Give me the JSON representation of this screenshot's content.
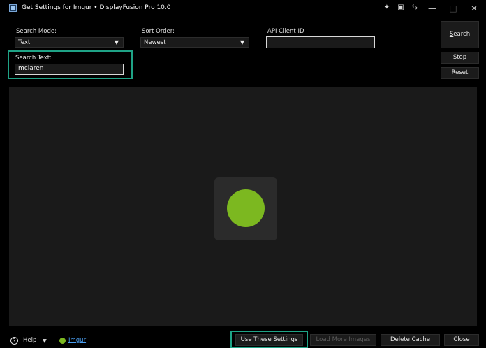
{
  "window": {
    "title": "Get Settings for Imgur • DisplayFusion Pro 10.0",
    "pin_icon": "pin-icon",
    "monitor_icon": "monitor-icon",
    "screen_icon": "screen-icon",
    "minimize": "—",
    "maximize": "□",
    "close": "✕"
  },
  "form": {
    "search_mode_label": "Search Mode:",
    "search_mode_value": "Text",
    "sort_order_label": "Sort Order:",
    "sort_order_value": "Newest",
    "api_client_label": "API Client ID",
    "api_client_value": "",
    "search_text_label": "Search Text:",
    "search_text_value": "mclaren",
    "caret": "▼"
  },
  "buttons": {
    "search_key": "S",
    "search_rest": "earch",
    "stop": "Stop",
    "reset_key": "R",
    "reset_rest": "eset"
  },
  "footer": {
    "help_icon": "?",
    "help_label": "Help",
    "help_caret": "▼",
    "imgur_link": "Imgur",
    "use_settings_key": "U",
    "use_settings_rest": "se These Settings",
    "load_more": "Load More Images",
    "delete_cache": "Delete Cache",
    "close": "Close"
  },
  "colors": {
    "highlight": "#1fa386",
    "loader": "#7cb820",
    "link": "#4a9ef0"
  }
}
